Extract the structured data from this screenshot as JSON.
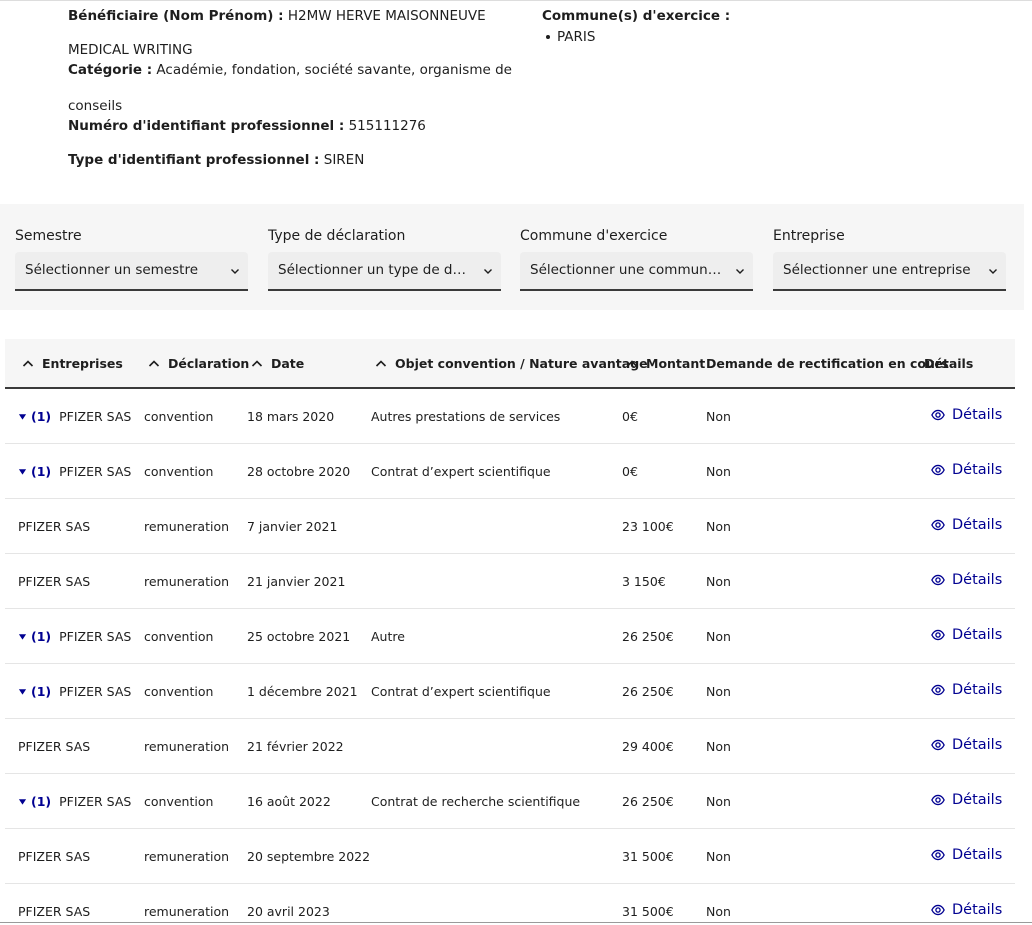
{
  "beneficiary": {
    "name_label": "Bénéficiaire (Nom Prénom) :",
    "name_value_line1": "H2MW HERVE MAISONNEUVE",
    "name_value_line2": "MEDICAL WRITING",
    "category_label": "Catégorie :",
    "category_value_line1": "Académie, fondation, société savante, organisme de",
    "category_value_line2": "conseils",
    "id_label": "Numéro d'identifiant professionnel :",
    "id_value": "515111276",
    "id_type_label": "Type d'identifiant professionnel :",
    "id_type_value": "SIREN",
    "communes_label": "Commune(s) d'exercice :",
    "communes": [
      "PARIS"
    ]
  },
  "filters": [
    {
      "label": "Semestre",
      "placeholder": "Sélectionner un semestre"
    },
    {
      "label": "Type de déclaration",
      "placeholder": "Sélectionner un type de déclaration"
    },
    {
      "label": "Commune d'exercice",
      "placeholder": "Sélectionner une commune d'exercice"
    },
    {
      "label": "Entreprise",
      "placeholder": "Sélectionner une entreprise"
    }
  ],
  "table": {
    "columns": {
      "entreprises": "Entreprises",
      "declaration": "Déclaration",
      "date": "Date",
      "objet": "Objet convention / Nature avantage",
      "montant": "Montant",
      "rectification": "Demande de rectification en cours",
      "details": "Détails"
    },
    "rows": [
      {
        "expand": "(1)",
        "entreprise": "PFIZER SAS",
        "declaration": "convention",
        "date": "18 mars 2020",
        "objet": "Autres prestations de services",
        "montant": "0€",
        "rectification": "Non",
        "details": "Détails"
      },
      {
        "expand": "(1)",
        "entreprise": "PFIZER SAS",
        "declaration": "convention",
        "date": "28 octobre 2020",
        "objet": "Contrat d’expert scientifique",
        "montant": "0€",
        "rectification": "Non",
        "details": "Détails"
      },
      {
        "expand": "",
        "entreprise": "PFIZER SAS",
        "declaration": "remuneration",
        "date": "7 janvier 2021",
        "objet": "",
        "montant": "23 100€",
        "rectification": "Non",
        "details": "Détails"
      },
      {
        "expand": "",
        "entreprise": "PFIZER SAS",
        "declaration": "remuneration",
        "date": "21 janvier 2021",
        "objet": "",
        "montant": "3 150€",
        "rectification": "Non",
        "details": "Détails"
      },
      {
        "expand": "(1)",
        "entreprise": "PFIZER SAS",
        "declaration": "convention",
        "date": "25 octobre 2021",
        "objet": "Autre",
        "montant": "26 250€",
        "rectification": "Non",
        "details": "Détails"
      },
      {
        "expand": "(1)",
        "entreprise": "PFIZER SAS",
        "declaration": "convention",
        "date": "1 décembre 2021",
        "objet": "Contrat d’expert scientifique",
        "montant": "26 250€",
        "rectification": "Non",
        "details": "Détails"
      },
      {
        "expand": "",
        "entreprise": "PFIZER SAS",
        "declaration": "remuneration",
        "date": "21 février 2022",
        "objet": "",
        "montant": "29 400€",
        "rectification": "Non",
        "details": "Détails"
      },
      {
        "expand": "(1)",
        "entreprise": "PFIZER SAS",
        "declaration": "convention",
        "date": "16 août 2022",
        "objet": "Contrat de recherche scientifique",
        "montant": "26 250€",
        "rectification": "Non",
        "details": "Détails"
      },
      {
        "expand": "",
        "entreprise": "PFIZER SAS",
        "declaration": "remuneration",
        "date": "20 septembre 2022",
        "objet": "",
        "montant": "31 500€",
        "rectification": "Non",
        "details": "Détails"
      },
      {
        "expand": "",
        "entreprise": "PFIZER SAS",
        "declaration": "remuneration",
        "date": "20 avril 2023",
        "objet": "",
        "montant": "31 500€",
        "rectification": "Non",
        "details": "Détails"
      }
    ]
  },
  "icons": {
    "sort": "chevron-up-icon",
    "select": "chevron-down-icon",
    "expand": "caret-down-icon",
    "details": "eye-icon"
  },
  "colors": {
    "accent": "#000091",
    "text": "#1e1e1e",
    "panel": "#f6f6f6",
    "select_bg": "#eeeeee"
  }
}
